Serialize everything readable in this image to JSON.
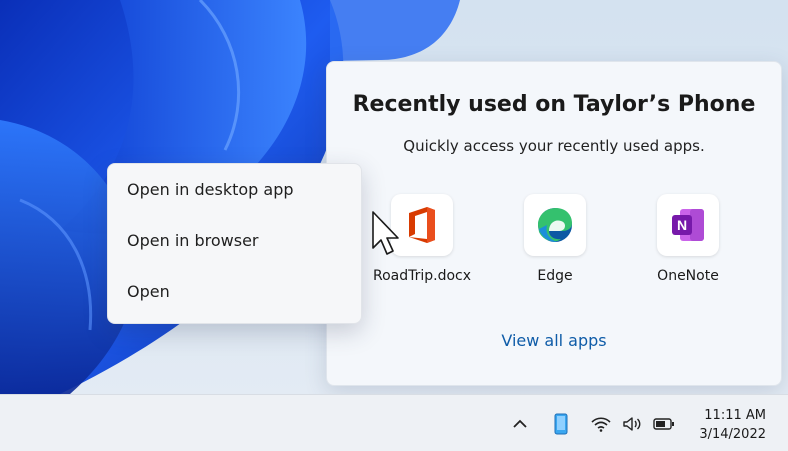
{
  "panel": {
    "title": "Recently used on Taylor’s Phone",
    "subtitle": "Quickly access your recently used apps.",
    "apps": [
      {
        "label": "RoadTrip.docx",
        "icon": "office-icon"
      },
      {
        "label": "Edge",
        "icon": "edge-icon"
      },
      {
        "label": "OneNote",
        "icon": "onenote-icon"
      }
    ],
    "view_all_label": "View all apps"
  },
  "context_menu": {
    "items": [
      "Open in desktop app",
      "Open in browser",
      "Open"
    ]
  },
  "taskbar": {
    "tray_icons": [
      "chevron-up-icon",
      "phone-icon",
      "wifi-icon",
      "volume-icon",
      "battery-icon"
    ],
    "time": "11:11 AM",
    "date": "3/14/2022"
  },
  "colors": {
    "link": "#0f5ca8",
    "office_red": "#d83b01",
    "onenote_purple": "#7719aa",
    "edge_blue": "#0c59a4",
    "edge_green": "#34c16e",
    "wallpaper_blue": "#1f4fd6"
  }
}
